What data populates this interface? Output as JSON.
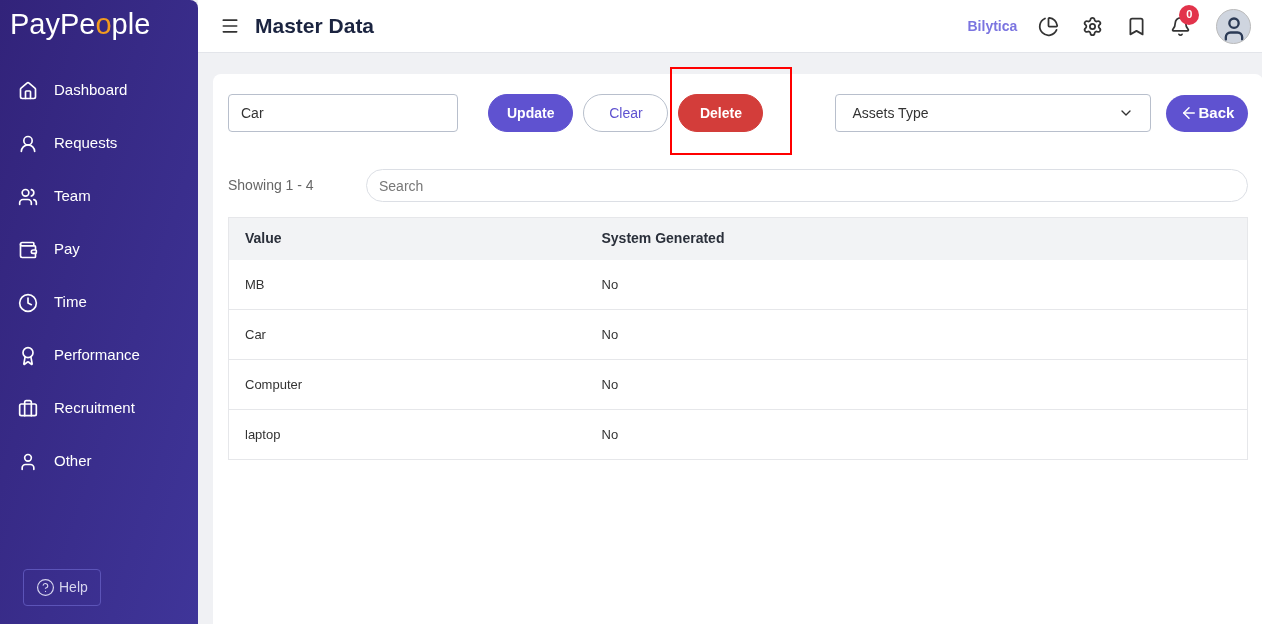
{
  "logo": {
    "before": "PayPe",
    "accent": "o",
    "after": "ple"
  },
  "sidebar": {
    "items": [
      {
        "label": "Dashboard"
      },
      {
        "label": "Requests"
      },
      {
        "label": "Team"
      },
      {
        "label": "Pay"
      },
      {
        "label": "Time"
      },
      {
        "label": "Performance"
      },
      {
        "label": "Recruitment"
      },
      {
        "label": "Other"
      }
    ],
    "help": "Help"
  },
  "header": {
    "title": "Master Data",
    "company": "Bilytica",
    "notifications": "0"
  },
  "form": {
    "value": "Car",
    "buttons": [
      {
        "label": "Update",
        "kind": "primary"
      },
      {
        "label": "Clear",
        "kind": "outline"
      },
      {
        "label": "Delete",
        "kind": "danger",
        "highlighted": true
      }
    ],
    "select": "Assets Type",
    "back": "Back"
  },
  "list": {
    "showing": "Showing 1 - 4",
    "search_placeholder": "Search"
  },
  "table": {
    "columns": [
      "Value",
      "System Generated"
    ],
    "rows": [
      [
        "MB",
        "No"
      ],
      [
        "Car",
        "No"
      ],
      [
        "Computer",
        "No"
      ],
      [
        "laptop",
        "No"
      ]
    ]
  }
}
